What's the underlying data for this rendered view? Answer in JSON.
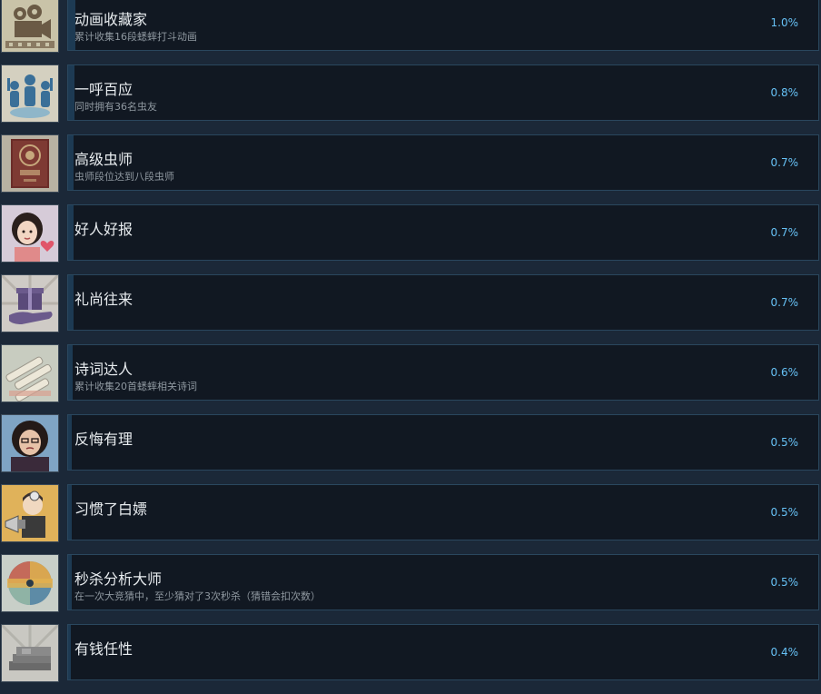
{
  "achievements": [
    {
      "title": "动画收藏家",
      "description": "累计收集16段蟋蟀打斗动画",
      "percent": "1.0%",
      "percent_value": 1.0,
      "icon": "film-camera-icon"
    },
    {
      "title": "一呼百应",
      "description": "同时拥有36名虫友",
      "percent": "0.8%",
      "percent_value": 0.8,
      "icon": "crowd-icon"
    },
    {
      "title": "高级虫师",
      "description": "虫师段位达到八段虫师",
      "percent": "0.7%",
      "percent_value": 0.7,
      "icon": "book-icon"
    },
    {
      "title": "好人好报",
      "description": "",
      "percent": "0.7%",
      "percent_value": 0.7,
      "icon": "girl-heart-icon"
    },
    {
      "title": "礼尚往来",
      "description": "",
      "percent": "0.7%",
      "percent_value": 0.7,
      "icon": "gift-hand-icon"
    },
    {
      "title": "诗词达人",
      "description": "累计收集20首蟋蟀相关诗词",
      "percent": "0.6%",
      "percent_value": 0.6,
      "icon": "scrolls-icon"
    },
    {
      "title": "反悔有理",
      "description": "",
      "percent": "0.5%",
      "percent_value": 0.5,
      "icon": "old-woman-icon"
    },
    {
      "title": "习惯了白嫖",
      "description": "",
      "percent": "0.5%",
      "percent_value": 0.5,
      "icon": "megaphone-man-icon"
    },
    {
      "title": "秒杀分析大师",
      "description": "在一次大竞猜中，至少猜对了3次秒杀（猜错会扣次数）",
      "percent": "0.5%",
      "percent_value": 0.5,
      "icon": "wheel-icon"
    },
    {
      "title": "有钱任性",
      "description": "",
      "percent": "0.4%",
      "percent_value": 0.4,
      "icon": "money-stack-icon"
    }
  ],
  "colors": {
    "page_background": "#1b2838",
    "row_background": "#111822",
    "row_border": "#2a475e",
    "title": "#e8ecef",
    "description": "#8f98a0",
    "percent": "#66c0f4"
  }
}
